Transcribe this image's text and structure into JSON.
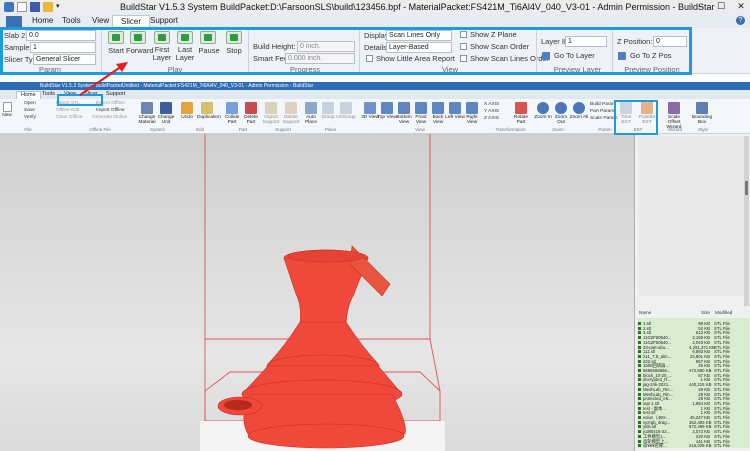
{
  "app": {
    "title": "BuildStar V1.5.3 System   BuildPacket:D:\\FarsoonSLS\\build\\123456.bpf - MaterialPacket:FS421M_Ti6Al4V_040_V3-01 - Admin Permission - BuildStar",
    "colors": {
      "highlight": "#1e9be0",
      "arrow": "#e02020",
      "part": "#f0483a",
      "play": "#2e9d3e"
    }
  },
  "tabs": [
    {
      "label": "Home"
    },
    {
      "label": "Tools"
    },
    {
      "label": "View"
    },
    {
      "label": "Slicer"
    },
    {
      "label": "Support"
    }
  ],
  "param": {
    "slab_label": "Slab 2:",
    "slab_value": "0.0",
    "sample_label": "Sample:",
    "sample_value": "1",
    "slicer_type_label": "Slicer Type",
    "slicer_type_value": "General Slicer",
    "group": "Param"
  },
  "play": {
    "buttons": [
      {
        "label": "Start"
      },
      {
        "label": "Forward"
      },
      {
        "label": "First Layer"
      },
      {
        "label": "Last Layer"
      },
      {
        "label": "Pause"
      },
      {
        "label": "Stop"
      }
    ],
    "group": "Play"
  },
  "progress": {
    "build_height_label": "Build Height:",
    "build_height_value": "0 inch.",
    "smart_feed_label": "Smart Feed:",
    "smart_feed_value": "0.000  inch.",
    "group": "Progress"
  },
  "view": {
    "display_label": "Display:",
    "display_value": "Scan Lines Only",
    "details_label": "Details:",
    "details_value": "Layer-Based",
    "show_little_area_report": "Show Little Area Report",
    "show_z_plane": "Show Z Plane",
    "show_scan_order": "Show Scan Order",
    "show_scan_lines_order": "Show Scan Lines Order",
    "group": "View"
  },
  "preview_layer": {
    "layer_id_label": "Layer ID:",
    "layer_id_value": "1",
    "go_to_layer": "Go To Layer",
    "group": "Preview Layer"
  },
  "preview_position": {
    "z_position_label": "Z Position:",
    "z_position_value": "0",
    "go_to_z_pos": "Go To Z Pos",
    "group": "Preview Position"
  },
  "inner": {
    "title": "BuildStar V1.5.3 System   BuildPacketUntitled - MaterialPacket:FS421M_Ti6Al4V_040_V3-01 - Admin Permission - BuildStar",
    "tabs": [
      {
        "label": "Home"
      },
      {
        "label": "Tools"
      },
      {
        "label": "View"
      },
      {
        "label": "Slicer"
      },
      {
        "label": "Support"
      }
    ],
    "ribbon": [
      {
        "label": "New"
      },
      {
        "label": "Change Material"
      },
      {
        "label": "Change Unit"
      },
      {
        "label": "Undo"
      },
      {
        "label": "Duplication"
      },
      {
        "label": "Collide Part"
      },
      {
        "label": "Delete Part"
      },
      {
        "label": "Import Support"
      },
      {
        "label": "Delete Support"
      },
      {
        "label": "Auto Place"
      },
      {
        "label": "Group"
      },
      {
        "label": "UnGroup"
      },
      {
        "label": "3D View"
      },
      {
        "label": "Top View"
      },
      {
        "label": "Bottom View"
      },
      {
        "label": "Front View"
      },
      {
        "label": "Back View"
      },
      {
        "label": "Left View"
      },
      {
        "label": "Right View"
      },
      {
        "label": "Rotate Part"
      },
      {
        "label": "Zoom In"
      },
      {
        "label": "Zoom Out"
      },
      {
        "label": "Zoom All"
      },
      {
        "label": "Time EST"
      },
      {
        "label": "Powder EST"
      },
      {
        "label": "Scale Offset Wizard"
      },
      {
        "label": "Bounding Box"
      }
    ],
    "small": {
      "open": "Open",
      "save": "Save",
      "verify": "Verify",
      "import_stl": "Import STL",
      "offline_edit": "Offline Edit",
      "clear_offline": "Clear Offline",
      "export_offline": "Export Offline",
      "import_offline": "Import Offline",
      "generate_online": "Generate Online",
      "x_axis": "X AXIS",
      "y_axis": "Y AXIS",
      "z_axis": "Z AXIS",
      "build_param": "Build Param",
      "part_param": "Part Param",
      "scale_param": "Scale Param"
    },
    "groups": {
      "file": "File",
      "offline_file": "Offline File",
      "system": "System",
      "edit": "Edit",
      "part": "Part",
      "support": "Support",
      "place": "Place",
      "view": "View",
      "transformation": "Transformation",
      "zoom": "Zoom",
      "param": "Param",
      "est": "EST",
      "wizard": "Wizard",
      "style": "Style"
    }
  },
  "files": {
    "headers": {
      "name": "Name",
      "size": "Size",
      "modified": "Modified"
    },
    "rows": [
      {
        "name": "1.stl",
        "size": "99 KB",
        "type": "STL File"
      },
      {
        "name": "2.stl",
        "size": "52 KB",
        "type": "STL File"
      },
      {
        "name": "3.stl",
        "size": "612 KB",
        "type": "STL File"
      },
      {
        "name": "11G2F50540...",
        "size": "2,159 KB",
        "type": "STL File"
      },
      {
        "name": "11G2F50540...",
        "size": "2,043 KB",
        "type": "STL File"
      },
      {
        "name": "33-part-ubu...",
        "size": "4,291,371 KB",
        "type": "STL File"
      },
      {
        "name": "111.stl",
        "size": "6,893 KB",
        "type": "STL File"
      },
      {
        "name": "211_7.8_alm...",
        "size": "23,801 KB",
        "type": "STL File"
      },
      {
        "name": "222.stl",
        "size": "957 KB",
        "type": "STL File"
      },
      {
        "name": "1500回转扇...",
        "size": "26 KB",
        "type": "STL File"
      },
      {
        "name": "6666666666...",
        "size": "472,590 KB",
        "type": "STL File"
      },
      {
        "name": "block_10-20_...",
        "size": "67 KB",
        "type": "STL File"
      },
      {
        "name": "decrypted_R...",
        "size": "1 KB",
        "type": "STL File"
      },
      {
        "name": "jag-24k-2021...",
        "size": "440,215 KB",
        "type": "STL File"
      },
      {
        "name": "MeshLab_Rin...",
        "size": "28 KB",
        "type": "STL File"
      },
      {
        "name": "MeshLab_Rin...",
        "size": "25 KB",
        "type": "STL File"
      },
      {
        "name": "protected_e6...",
        "size": "25 KB",
        "type": "STL File"
      },
      {
        "name": "sup 1.stl",
        "size": "1,984 KB",
        "type": "STL File"
      },
      {
        "name": "test - 副本...",
        "size": "1 KB",
        "type": "STL File"
      },
      {
        "name": "test.stl",
        "size": "1 KB",
        "type": "STL File"
      },
      {
        "name": "volun（400-...",
        "size": "45,247 KB",
        "type": "STL File"
      },
      {
        "name": "xyzrgb_drag...",
        "size": "352,493 KB",
        "type": "STL File"
      },
      {
        "name": "ylds.stl",
        "size": "572,499 KB",
        "type": "STL File"
      },
      {
        "name": "jcd80415-22...",
        "size": "2,073 KB",
        "type": "STL File"
      },
      {
        "name": "工件模型1...",
        "size": "220 KB",
        "type": "STL File"
      },
      {
        "name": "齿轮模型上...",
        "size": "141 KB",
        "type": "STL File"
      },
      {
        "name": "@¥¥¥名称...",
        "size": "216,025 KB",
        "type": "STL File"
      }
    ]
  }
}
